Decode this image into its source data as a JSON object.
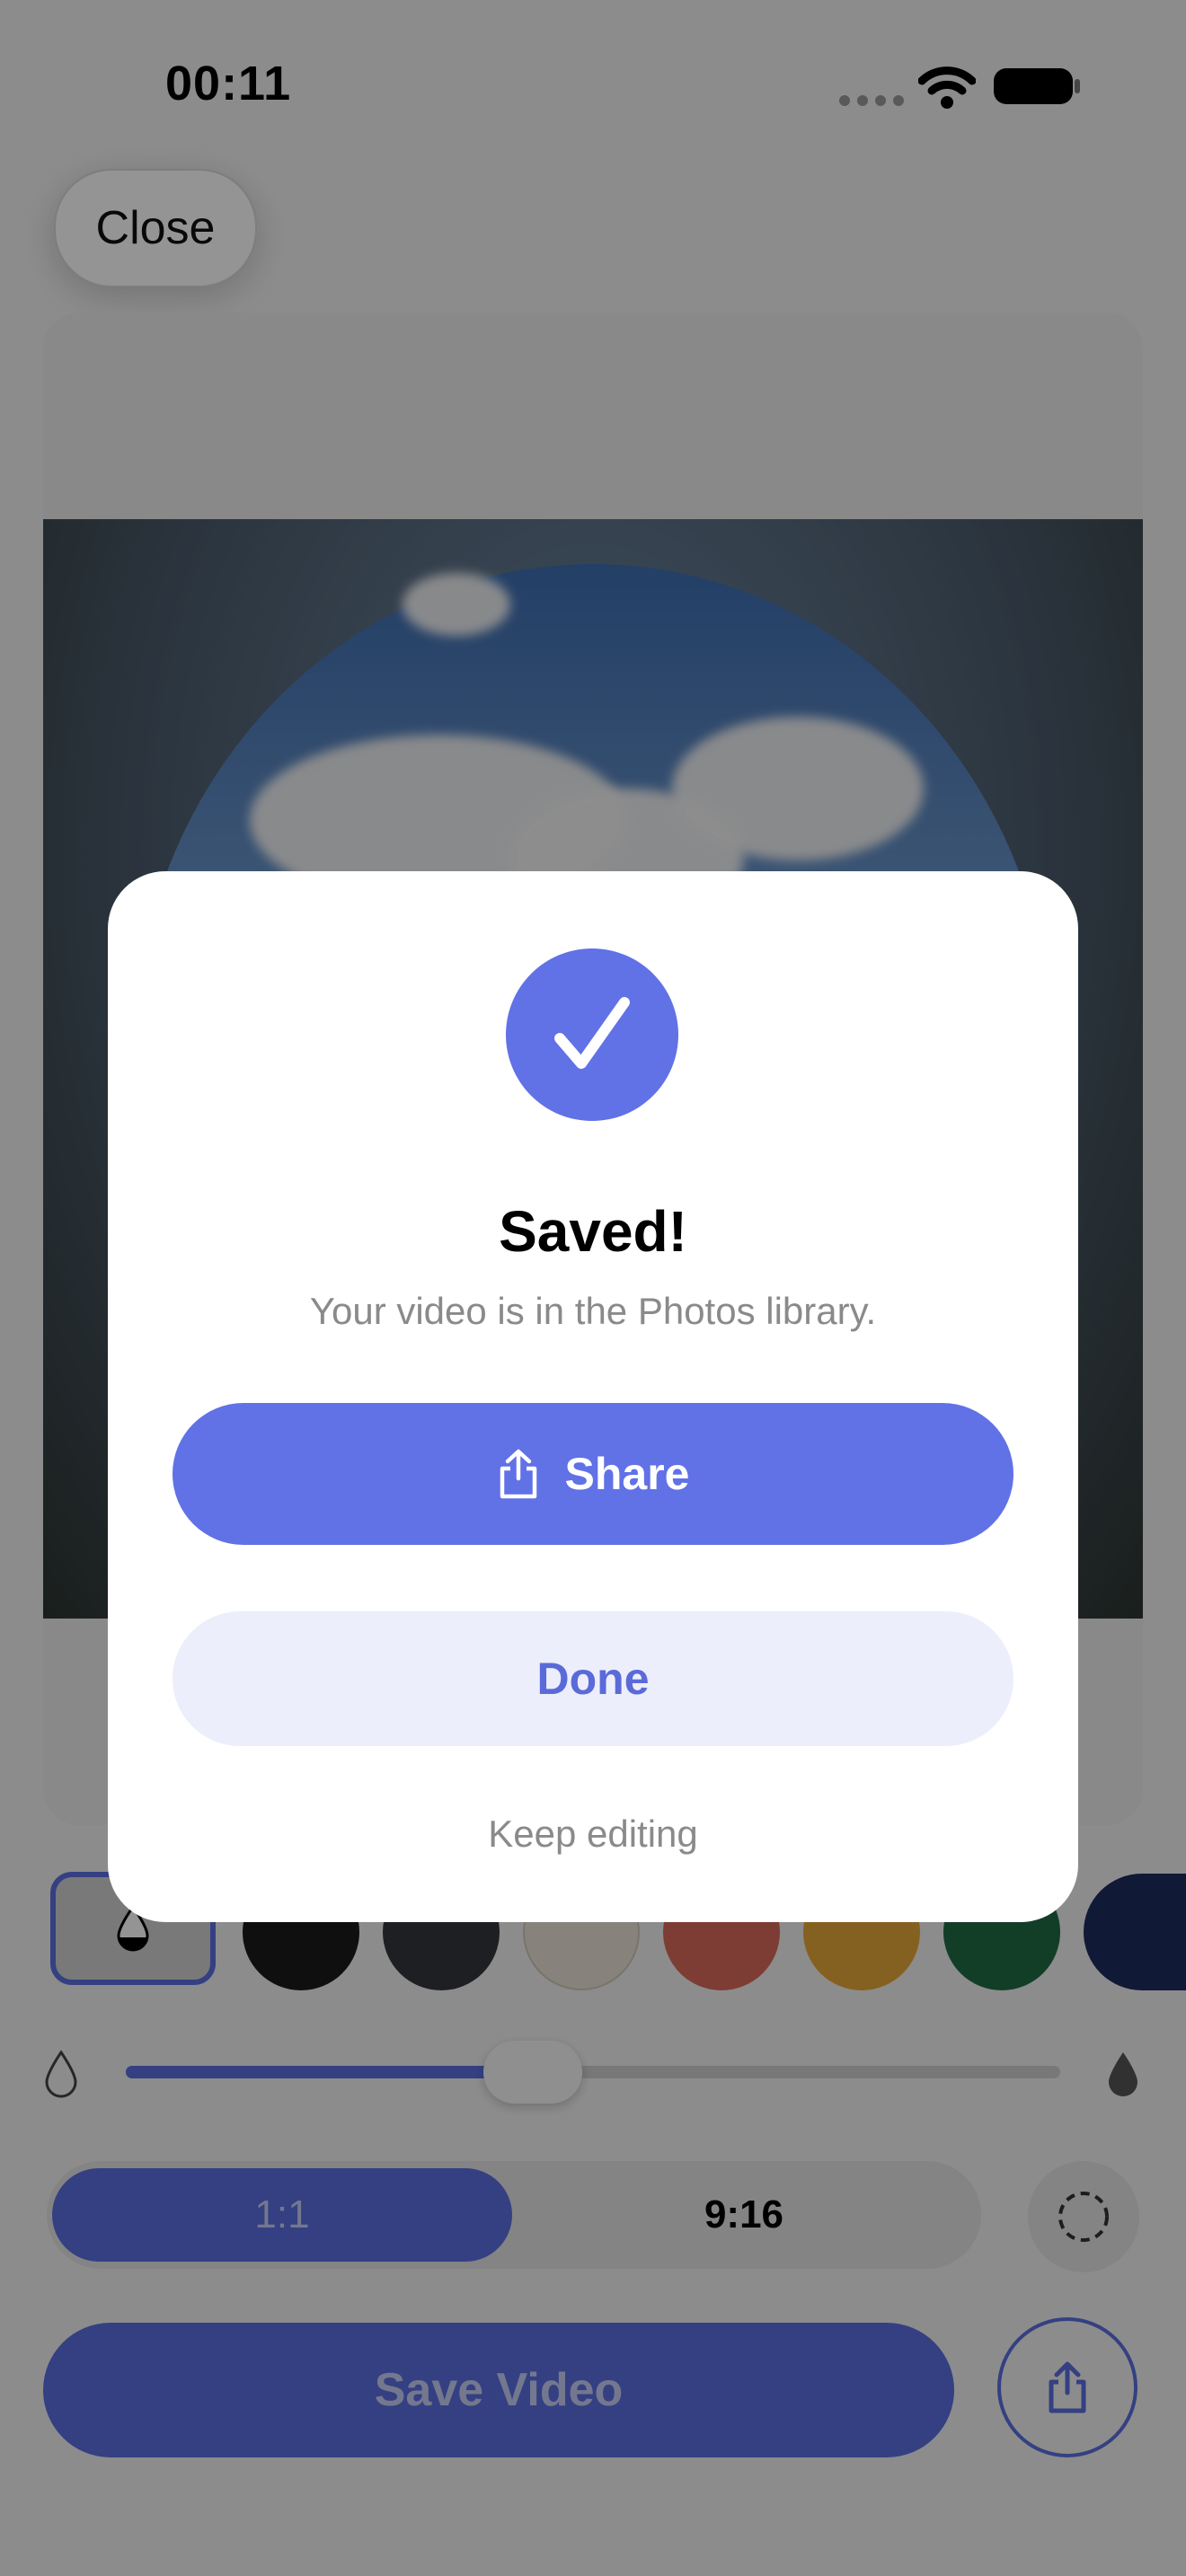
{
  "status_bar": {
    "time": "00:11"
  },
  "top": {
    "close_label": "Close"
  },
  "palette": {
    "colors": [
      "#1a1a1a",
      "#33363b",
      "#e8e2d6",
      "#d8695a",
      "#e6a83a",
      "#1f6b45",
      "#1c2b5c"
    ]
  },
  "aspect": {
    "option_1": "1:1",
    "option_2": "9:16",
    "selected": "1:1"
  },
  "bottom": {
    "save_label": "Save Video"
  },
  "modal": {
    "title": "Saved!",
    "subtitle": "Your video is in the Photos library.",
    "share_label": "Share",
    "done_label": "Done",
    "keep_editing_label": "Keep editing"
  },
  "slider": {
    "value": 0.44
  },
  "theme": {
    "accent": "#6171e6",
    "accent_light": "#eceefb"
  }
}
